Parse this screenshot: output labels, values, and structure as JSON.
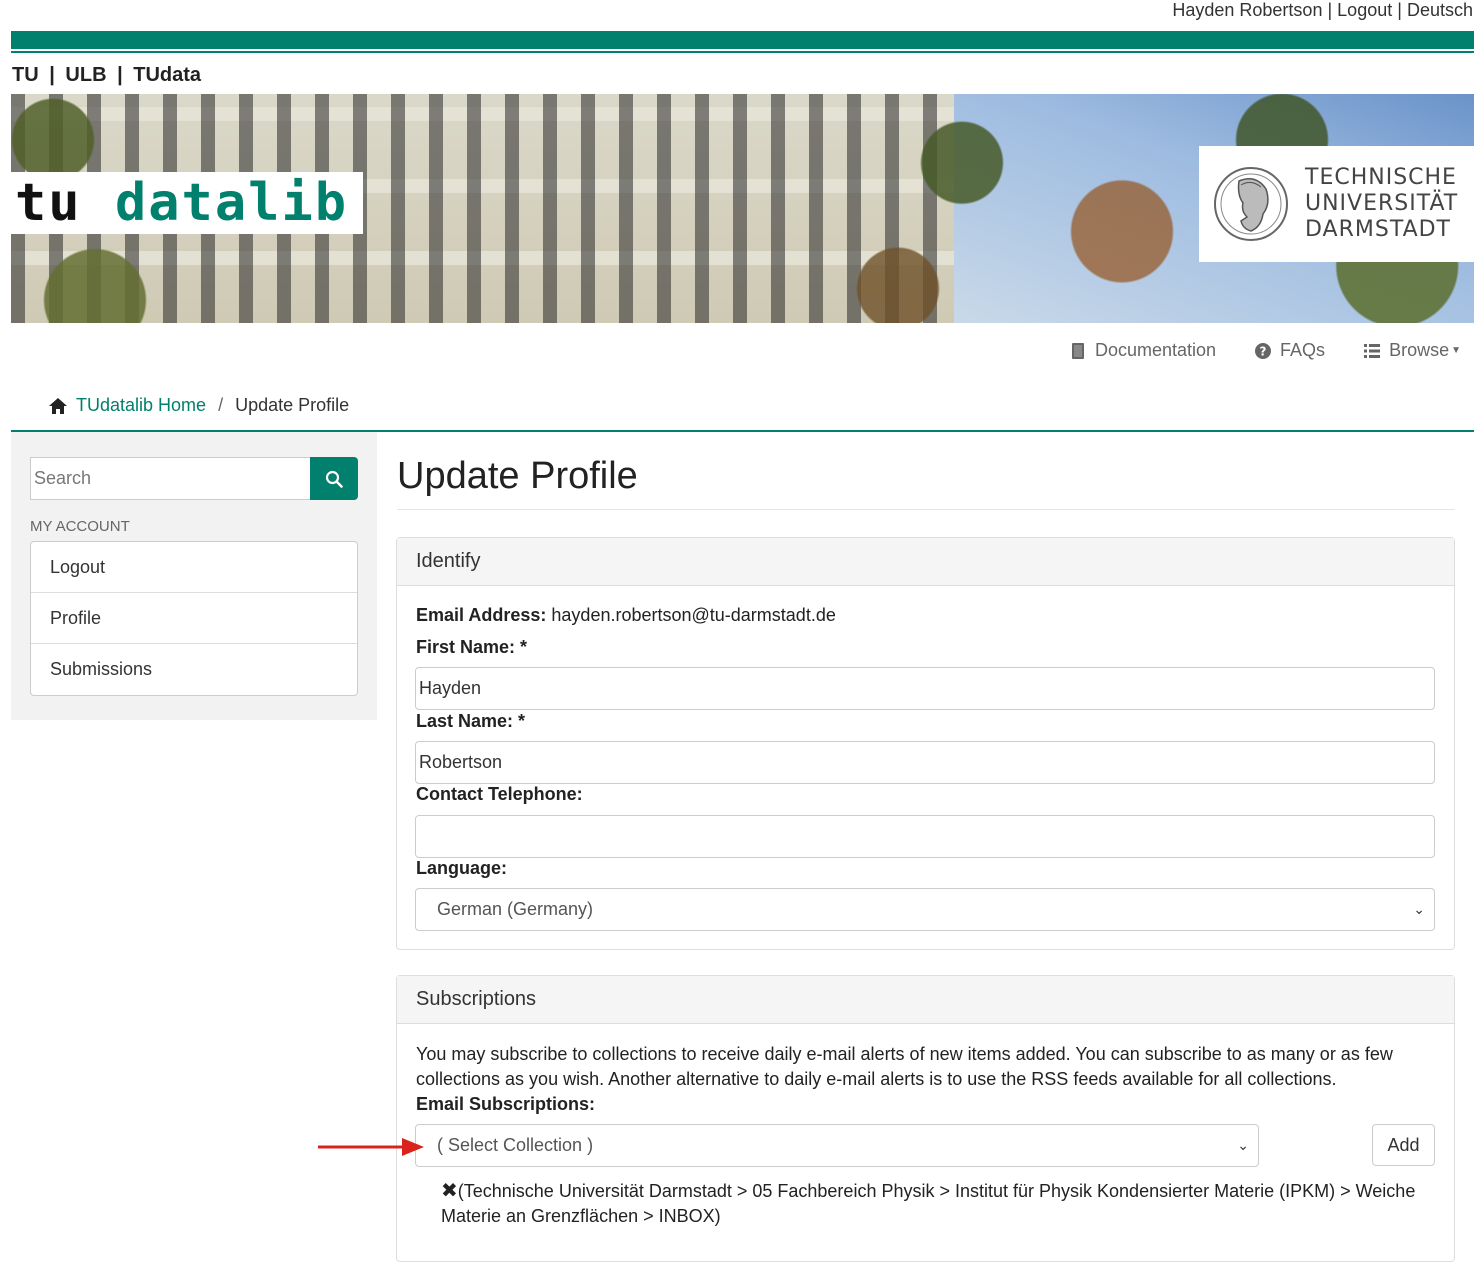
{
  "userbar": {
    "user_name": "Hayden Robertson",
    "logout": "Logout",
    "language": "Deutsch",
    "separator": "|"
  },
  "sitelinks": {
    "tu": "TU",
    "ulb": "ULB",
    "tudata": "TUdata",
    "separator": "|"
  },
  "banner": {
    "logo_tu": "TU",
    "logo_datalib": "datalib",
    "university_line1": "TECHNISCHE",
    "university_line2": "UNIVERSITÄT",
    "university_line3": "DARMSTADT"
  },
  "nav": {
    "documentation": "Documentation",
    "faqs": "FAQs",
    "browse": "Browse"
  },
  "breadcrumb": {
    "home": "TUdatalib Home",
    "separator": "/",
    "current": "Update Profile"
  },
  "sidebar": {
    "search_placeholder": "Search",
    "section_title": "MY ACCOUNT",
    "items": [
      {
        "label": "Logout"
      },
      {
        "label": "Profile"
      },
      {
        "label": "Submissions"
      }
    ]
  },
  "main": {
    "title": "Update Profile",
    "identify": {
      "heading": "Identify",
      "email_label": "Email Address:",
      "email_value": "hayden.robertson@tu-darmstadt.de",
      "first_name_label": "First Name: *",
      "first_name_value": "Hayden",
      "last_name_label": "Last Name: *",
      "last_name_value": "Robertson",
      "telephone_label": "Contact Telephone:",
      "telephone_value": "",
      "language_label": "Language:",
      "language_value": "German (Germany)"
    },
    "subscriptions": {
      "heading": "Subscriptions",
      "description": "You may subscribe to collections to receive daily e-mail alerts of new items added. You can subscribe to as many or as few collections as you wish. Another alternative to daily e-mail alerts is to use the RSS feeds available for all collections.",
      "email_label": "Email Subscriptions:",
      "select_value": "( Select Collection )",
      "add_button": "Add",
      "remove_glyph": "✖",
      "current_subscription": "(Technische Universität Darmstadt > 05 Fachbereich Physik > Institut für Physik Kondensierter Materie (IPKM) > Weiche Materie an Grenzflächen > INBOX)"
    }
  },
  "colors": {
    "brand": "#00806d",
    "annotation_arrow": "#d9231c"
  }
}
